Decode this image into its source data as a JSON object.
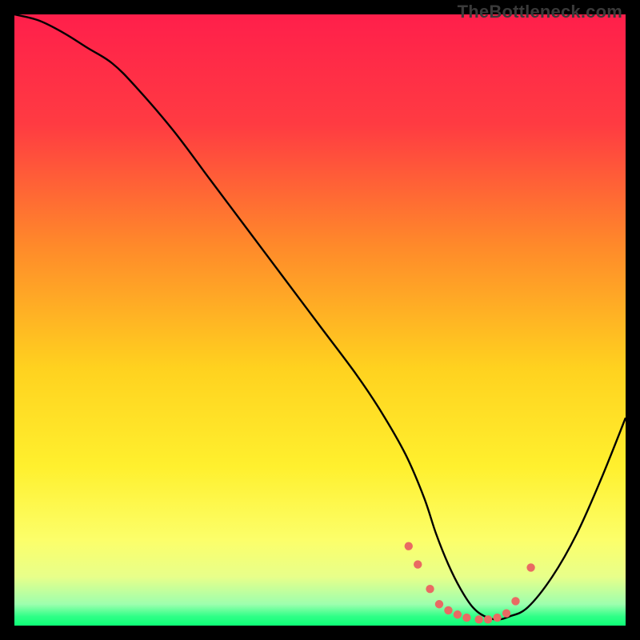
{
  "watermark": "TheBottleneck.com",
  "chart_data": {
    "type": "line",
    "title": "",
    "xlabel": "",
    "ylabel": "",
    "xlim": [
      0,
      100
    ],
    "ylim": [
      0,
      100
    ],
    "grid": false,
    "background_gradient": {
      "stops": [
        {
          "offset": 0.0,
          "color": "#ff1f4b"
        },
        {
          "offset": 0.18,
          "color": "#ff3b42"
        },
        {
          "offset": 0.38,
          "color": "#ff8a2a"
        },
        {
          "offset": 0.58,
          "color": "#ffd21f"
        },
        {
          "offset": 0.74,
          "color": "#fff02e"
        },
        {
          "offset": 0.86,
          "color": "#fcff6a"
        },
        {
          "offset": 0.92,
          "color": "#e8ff8a"
        },
        {
          "offset": 0.965,
          "color": "#9dffae"
        },
        {
          "offset": 0.985,
          "color": "#2fff87"
        },
        {
          "offset": 1.0,
          "color": "#0eff77"
        }
      ]
    },
    "series": [
      {
        "name": "bottleneck-curve",
        "color": "#000000",
        "stroke_width": 2.4,
        "x": [
          0,
          4,
          8,
          12,
          16,
          20,
          26,
          32,
          38,
          44,
          50,
          56,
          60,
          64,
          67,
          69,
          71,
          73,
          75,
          77,
          79,
          81,
          84,
          88,
          92,
          96,
          100
        ],
        "y": [
          100,
          99,
          97,
          94.5,
          92,
          88,
          81,
          73,
          65,
          57,
          49,
          41,
          35,
          28,
          21,
          15,
          10,
          6,
          3,
          1.5,
          1,
          1.5,
          3,
          8,
          15,
          24,
          34
        ]
      }
    ],
    "markers": {
      "name": "valley-markers",
      "color": "#e96a63",
      "radius": 5.2,
      "points": [
        {
          "x": 64.5,
          "y": 13.0
        },
        {
          "x": 66.0,
          "y": 10.0
        },
        {
          "x": 68.0,
          "y": 6.0
        },
        {
          "x": 69.5,
          "y": 3.5
        },
        {
          "x": 71.0,
          "y": 2.5
        },
        {
          "x": 72.5,
          "y": 1.8
        },
        {
          "x": 74.0,
          "y": 1.3
        },
        {
          "x": 76.0,
          "y": 1.0
        },
        {
          "x": 77.5,
          "y": 1.0
        },
        {
          "x": 79.0,
          "y": 1.3
        },
        {
          "x": 80.5,
          "y": 2.0
        },
        {
          "x": 82.0,
          "y": 4.0
        },
        {
          "x": 84.5,
          "y": 9.5
        }
      ]
    }
  }
}
